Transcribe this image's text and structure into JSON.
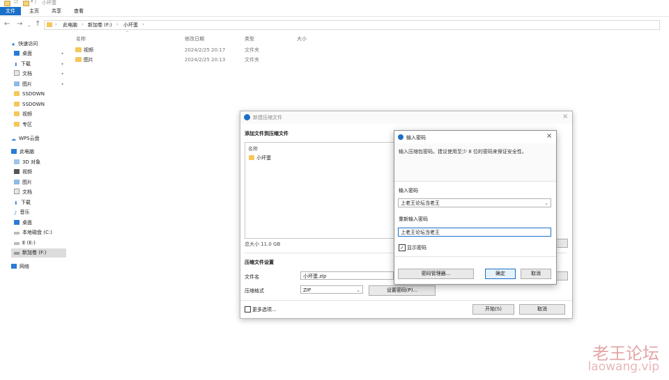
{
  "window": {
    "title": "小坏蛋"
  },
  "ribbon": {
    "tabs": [
      "文件",
      "主页",
      "共享",
      "查看"
    ]
  },
  "address": {
    "crumbs": [
      "此电脑",
      "新加卷 (F:)",
      "小坏蛋"
    ]
  },
  "columns": {
    "name": "名称",
    "date": "修改日期",
    "type": "类型",
    "size": "大小"
  },
  "nav": {
    "quick_access": "快速访问",
    "items": [
      {
        "label": "桌面",
        "icon": "desktop-icon",
        "pinned": true
      },
      {
        "label": "下载",
        "icon": "download-icon",
        "pinned": true
      },
      {
        "label": "文档",
        "icon": "documents-icon",
        "pinned": true
      },
      {
        "label": "图片",
        "icon": "pictures-icon",
        "pinned": true
      },
      {
        "label": "SSDOWN",
        "icon": "folder-icon"
      },
      {
        "label": "SSDOWN",
        "icon": "folder-icon"
      },
      {
        "label": "视频",
        "icon": "folder-icon"
      },
      {
        "label": "专区",
        "icon": "folder-icon"
      }
    ],
    "wps": "WPS云盘",
    "this_pc": "此电脑",
    "pc_items": [
      {
        "label": "3D 对象",
        "icon": "3d-objects-icon"
      },
      {
        "label": "视频",
        "icon": "videos-icon"
      },
      {
        "label": "图片",
        "icon": "pictures-icon"
      },
      {
        "label": "文档",
        "icon": "documents-icon"
      },
      {
        "label": "下载",
        "icon": "download-icon"
      },
      {
        "label": "音乐",
        "icon": "music-icon"
      },
      {
        "label": "桌面",
        "icon": "desktop-icon"
      },
      {
        "label": "本地磁盘 (C:)",
        "icon": "drive-icon"
      },
      {
        "label": "E (E:)",
        "icon": "drive-icon"
      },
      {
        "label": "新加卷 (F:)",
        "icon": "drive-icon",
        "selected": true
      }
    ],
    "network": "网络"
  },
  "files": [
    {
      "name": "视频",
      "date": "2024/2/25 20:17",
      "type": "文件夹"
    },
    {
      "name": "图片",
      "date": "2024/2/25 20:13",
      "type": "文件夹"
    }
  ],
  "compress_dialog": {
    "title": "新建压缩文件",
    "section_add": "添加文件到压缩文件",
    "list_header": "名称",
    "list_item": "小坏蛋",
    "total_size": "总大小 11.0 GB",
    "section_settings": "压缩文件设置",
    "filename_label": "文件名",
    "filename_value": "小坏蛋.zip",
    "format_label": "压缩格式",
    "format_value": "ZIP",
    "set_password": "设置密码(P)...",
    "more_options": "更多选项...",
    "start": "开始(S)",
    "cancel": "取消"
  },
  "password_dialog": {
    "title": "输入密码",
    "hint": "输入压缩包密码。建议使用至少 8 位的密码来保证安全性。",
    "password_label": "输入密码",
    "password_value": "上老王论坛当老王",
    "repeat_label": "重新输入密码",
    "repeat_value": "上老王论坛当老王",
    "show_password": "显示密码",
    "manager": "密码管理器...",
    "ok": "确定",
    "cancel": "取消"
  },
  "watermark": {
    "line1": "老王论坛",
    "line2": "laowang.vip"
  },
  "colors": {
    "accent": "#1a6fc8",
    "folder": "#f5c75a",
    "watermark": "#e3a6a8"
  }
}
